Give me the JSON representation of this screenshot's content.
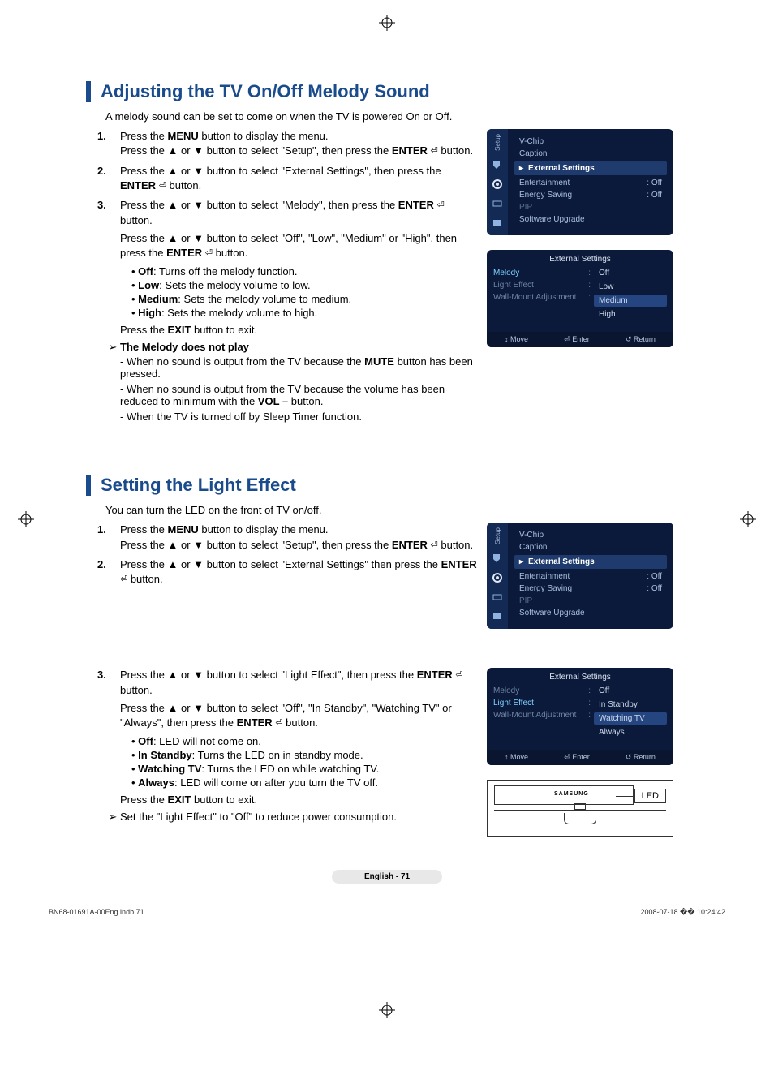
{
  "section1": {
    "title": "Adjusting the TV On/Off Melody Sound",
    "intro": "A melody sound can be set to come on when the TV is powered On or Off.",
    "steps": [
      {
        "num": "1.",
        "html": "Press the <b>MENU</b> button to display the menu.<br>Press the ▲ or ▼ button to select \"Setup\", then press the <b>ENTER</b> <span class='enter-icon'>⏎</span> button."
      },
      {
        "num": "2.",
        "html": "Press the ▲ or ▼ button to select \"External Settings\", then press the <b>ENTER</b> <span class='enter-icon'>⏎</span> button."
      },
      {
        "num": "3.",
        "html": "Press the ▲ or ▼ button to select \"Melody\", then press the <b>ENTER</b> <span class='enter-icon'>⏎</span> button.<div class='sub'>Press the ▲ or ▼ button to select \"Off\", \"Low\", \"Medium\" or \"High\", then press the <b>ENTER</b> <span class='enter-icon'>⏎</span> button.</div>"
      }
    ],
    "bullets": [
      "<b>Off</b>: Turns off the melody function.",
      "<b>Low</b>: Sets the melody volume to low.",
      "<b>Medium</b>: Sets the melody volume to medium.",
      "<b>High</b>: Sets the melody volume to high."
    ],
    "exit": "Press the <b>EXIT</b> button to exit.",
    "note_title": "The Melody does not play",
    "notes": [
      "- When no sound is output from the TV because the <b>MUTE</b> button has been pressed.",
      "- When no sound is output from the TV because the volume has been reduced to minimum with the <b>VOL –</b> button.",
      "- When the TV is turned off by Sleep Timer function."
    ]
  },
  "section2": {
    "title": "Setting the Light Effect",
    "intro": "You can turn the LED on the front of TV on/off.",
    "steps_a": [
      {
        "num": "1.",
        "html": "Press the <b>MENU</b> button to display the menu.<br>Press the ▲ or ▼ button to select \"Setup\", then press the <b>ENTER</b> <span class='enter-icon'>⏎</span> button."
      },
      {
        "num": "2.",
        "html": "Press the ▲ or ▼ button to select \"External Settings\" then press the <b>ENTER</b> <span class='enter-icon'>⏎</span> button."
      }
    ],
    "steps_b": [
      {
        "num": "3.",
        "html": "Press the ▲ or ▼ button to select \"Light Effect\", then press the <b>ENTER</b> <span class='enter-icon'>⏎</span> button.<div class='sub'>Press the ▲ or ▼ button to select \"Off\", \"In Standby\", \"Watching TV\" or \"Always\", then press the <b>ENTER</b> <span class='enter-icon'>⏎</span> button.</div>"
      }
    ],
    "bullets": [
      "<b>Off</b>: LED will not come on.",
      "<b>In Standby</b>: Turns the LED on in standby mode.",
      "<b>Watching TV</b>: Turns the LED on while watching TV.",
      "<b>Always</b>: LED will come on after you turn the TV off."
    ],
    "exit": "Press the <b>EXIT</b> button to exit.",
    "note": "Set the \"Light Effect\" to \"Off\" to reduce power consumption."
  },
  "osd_setup": {
    "tab": "Setup",
    "items_top": [
      "V-Chip",
      "Caption"
    ],
    "highlight": "External Settings",
    "items_below": [
      {
        "l": "Entertainment",
        "r": ": Off"
      },
      {
        "l": "Energy Saving",
        "r": ": Off"
      },
      {
        "l": "PIP",
        "r": ""
      },
      {
        "l": "Software Upgrade",
        "r": ""
      }
    ]
  },
  "osd_melody": {
    "title": "External Settings",
    "left": [
      {
        "t": "Melody",
        "active": true
      },
      {
        "t": "Light Effect",
        "active": false
      },
      {
        "t": "Wall-Mount Adjustment",
        "active": false
      }
    ],
    "opts": [
      "Off",
      "Low",
      "Medium",
      "High"
    ],
    "sel": "Medium",
    "footer": [
      "↕ Move",
      "⏎ Enter",
      "↺ Return"
    ]
  },
  "osd_light": {
    "title": "External Settings",
    "left": [
      {
        "t": "Melody",
        "active": false
      },
      {
        "t": "Light Effect",
        "active": true
      },
      {
        "t": "Wall-Mount Adjustment",
        "active": false
      }
    ],
    "opts": [
      "Off",
      "In Standby",
      "Watching TV",
      "Always"
    ],
    "sel": "Watching TV",
    "footer": [
      "↕ Move",
      "⏎ Enter",
      "↺ Return"
    ]
  },
  "led_label": "LED",
  "brand": "SAMSUNG",
  "footer_page": "English - 71",
  "file_left": "BN68-01691A-00Eng.indb   71",
  "file_right": "2008-07-18   �� 10:24:42"
}
